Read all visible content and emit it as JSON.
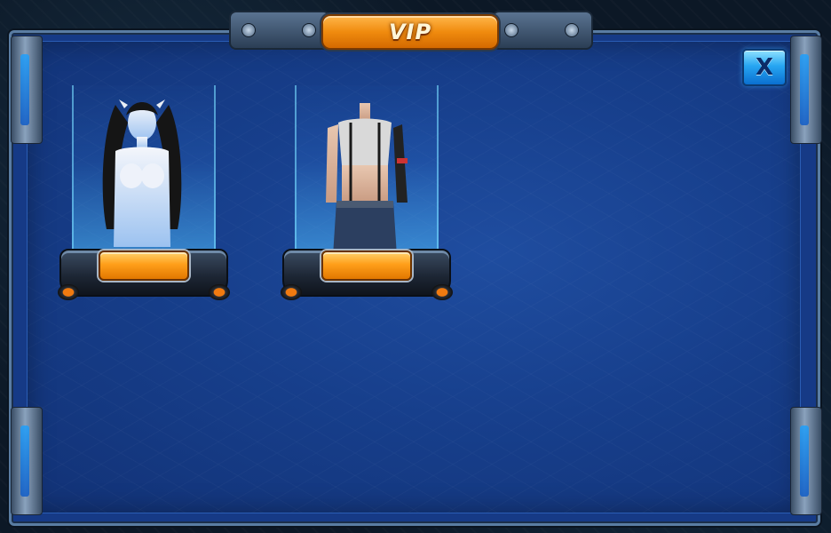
{
  "dialog": {
    "title": "VIP",
    "close_label": "X"
  },
  "items": [
    {
      "name": "white-hair-avatar",
      "button_label": ""
    },
    {
      "name": "crop-top-outfit",
      "button_label": ""
    }
  ],
  "colors": {
    "panel": "#173f8c",
    "title_plate": "#f08b0e",
    "close_button": "#27a6f2",
    "buy_button": "#ff9f1a"
  }
}
